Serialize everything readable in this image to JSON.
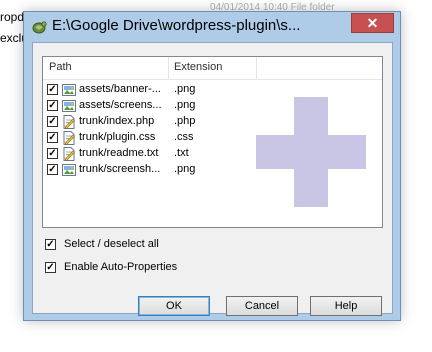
{
  "background": {
    "line1_left": "ropd",
    "line2_left": "exclu",
    "faint_text": "04/01/2014 10:40      File folder"
  },
  "dialog": {
    "title": "E:\\Google Drive\\wordpress-plugin\\s...",
    "close_label": "✕",
    "list": {
      "columns": [
        "Path",
        "Extension"
      ],
      "rows": [
        {
          "checked": true,
          "icon": "image-file-icon",
          "path": "assets/banner-...",
          "ext": ".png"
        },
        {
          "checked": true,
          "icon": "image-file-icon",
          "path": "assets/screens...",
          "ext": ".png"
        },
        {
          "checked": true,
          "icon": "text-file-icon",
          "path": "trunk/index.php",
          "ext": ".php"
        },
        {
          "checked": true,
          "icon": "text-file-icon",
          "path": "trunk/plugin.css",
          "ext": ".css"
        },
        {
          "checked": true,
          "icon": "text-file-icon",
          "path": "trunk/readme.txt",
          "ext": ".txt"
        },
        {
          "checked": true,
          "icon": "image-file-icon",
          "path": "trunk/screensh...",
          "ext": ".png"
        }
      ]
    },
    "select_all": {
      "checked": true,
      "label": "Select / deselect all"
    },
    "auto_props": {
      "checked": true,
      "label": "Enable Auto-Properties"
    },
    "buttons": {
      "ok": "OK",
      "cancel": "Cancel",
      "help": "Help"
    }
  },
  "colors": {
    "frame": "#aecbe8",
    "close": "#c75050",
    "watermark": "#c8c6e4"
  }
}
